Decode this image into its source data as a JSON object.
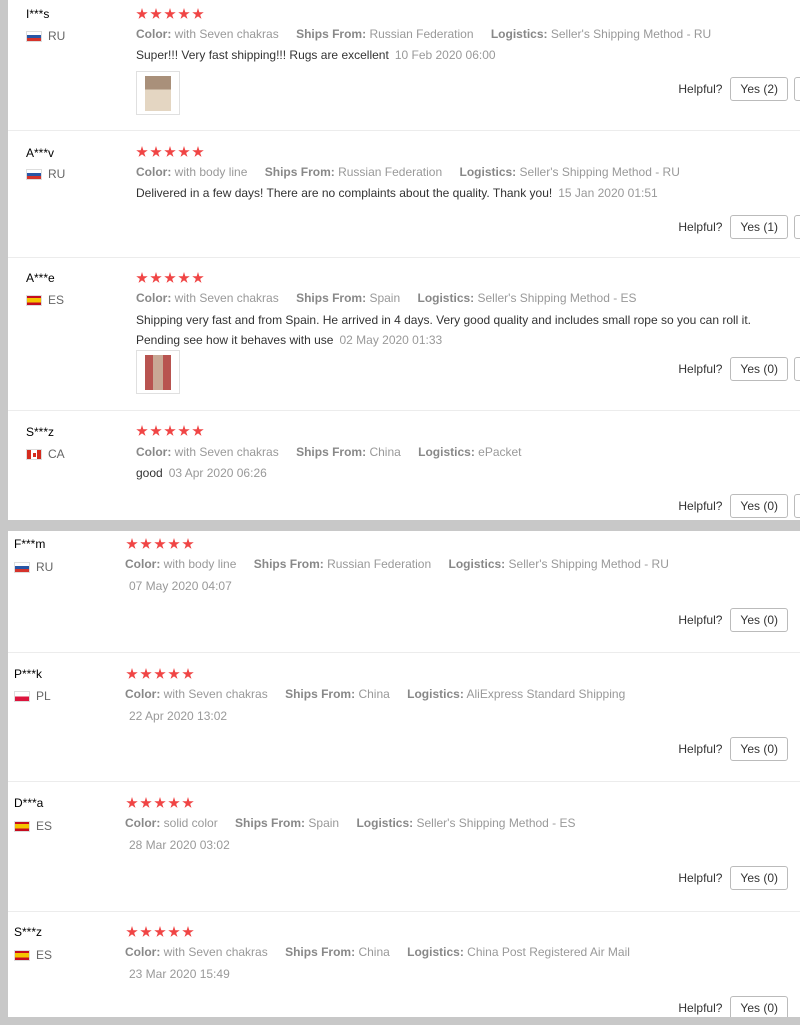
{
  "labels": {
    "color": "Color:",
    "ships_from": "Ships From:",
    "logistics": "Logistics:",
    "helpful": "Helpful?"
  },
  "colors": {
    "star": "#f04545",
    "muted": "#999999"
  },
  "reviews_top": [
    {
      "user": "I***s",
      "country": "RU",
      "flag": "flag-ru",
      "color": "with Seven chakras",
      "ships_from": "Russian Federation",
      "logistics": "Seller's Shipping Method - RU",
      "text": "Super!!! Very fast shipping!!! Rugs are excellent",
      "date": "10 Feb 2020 06:00",
      "helpful": "Yes (2)",
      "has_photo": true
    },
    {
      "user": "A***v",
      "country": "RU",
      "flag": "flag-ru",
      "color": "with body line",
      "ships_from": "Russian Federation",
      "logistics": "Seller's Shipping Method - RU",
      "text": "Delivered in a few days! There are no complaints about the quality. Thank you!",
      "date": "15 Jan 2020 01:51",
      "helpful": "Yes (1)",
      "has_photo": false
    },
    {
      "user": "A***e",
      "country": "ES",
      "flag": "flag-es",
      "color": "with Seven chakras",
      "ships_from": "Spain",
      "logistics": "Seller's Shipping Method - ES",
      "text_line1": "Shipping very fast and from Spain. He arrived in 4 days. Very good quality and includes small rope so you can roll it.",
      "text_line2": "Pending see how it behaves with use",
      "date": "02 May 2020 01:33",
      "helpful": "Yes (0)",
      "has_photo": true
    },
    {
      "user": "S***z",
      "country": "CA",
      "flag": "flag-ca",
      "color": "with Seven chakras",
      "ships_from": "China",
      "logistics": "ePacket",
      "text": "good",
      "date": "03 Apr 2020 06:26",
      "helpful": "Yes (0)",
      "has_photo": false
    }
  ],
  "reviews_bottom": [
    {
      "user": "F***m",
      "country": "RU",
      "flag": "flag-ru",
      "color": "with body line",
      "ships_from": "Russian Federation",
      "logistics": "Seller's Shipping Method - RU",
      "date": "07 May 2020 04:07",
      "helpful": "Yes (0)"
    },
    {
      "user": "P***k",
      "country": "PL",
      "flag": "flag-pl",
      "color": "with Seven chakras",
      "ships_from": "China",
      "logistics": "AliExpress Standard Shipping",
      "date": "22 Apr 2020 13:02",
      "helpful": "Yes (0)"
    },
    {
      "user": "D***a",
      "country": "ES",
      "flag": "flag-es",
      "color": "solid color",
      "ships_from": "Spain",
      "logistics": "Seller's Shipping Method - ES",
      "date": "28 Mar 2020 03:02",
      "helpful": "Yes (0)"
    },
    {
      "user": "S***z",
      "country": "ES",
      "flag": "flag-es",
      "color": "with Seven chakras",
      "ships_from": "China",
      "logistics": "China Post Registered Air Mail",
      "date": "23 Mar 2020 15:49",
      "helpful": "Yes (0)"
    }
  ]
}
